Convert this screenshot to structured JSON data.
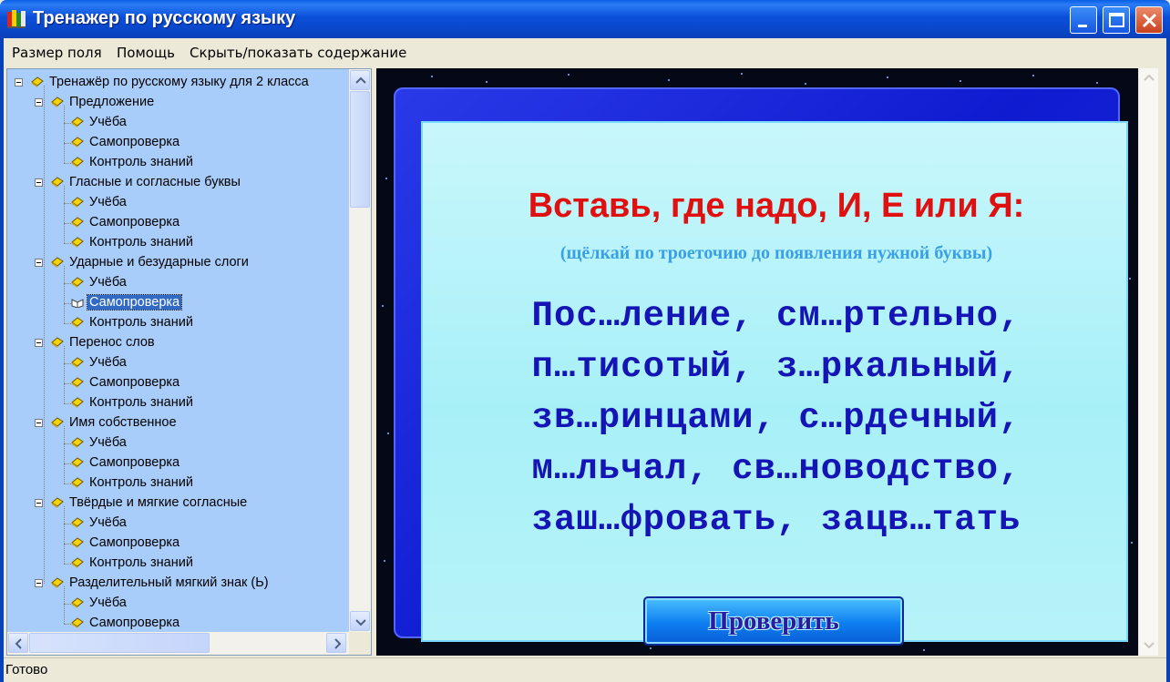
{
  "window": {
    "title": "Тренажер по русскому языку"
  },
  "menu": {
    "items": [
      "Размер поля",
      "Помощь",
      "Скрыть/показать содержание"
    ]
  },
  "tree": {
    "root": "Тренажёр по русскому языку для 2 класса",
    "sections": [
      {
        "label": "Предложение",
        "children": [
          "Учёба",
          "Самопроверка",
          "Контроль знаний"
        ]
      },
      {
        "label": "Гласные и согласные буквы",
        "children": [
          "Учёба",
          "Самопроверка",
          "Контроль знаний"
        ]
      },
      {
        "label": "Ударные и безударные слоги",
        "children": [
          "Учёба",
          "Самопроверка",
          "Контроль знаний"
        ]
      },
      {
        "label": "Перенос слов",
        "children": [
          "Учёба",
          "Самопроверка",
          "Контроль знаний"
        ]
      },
      {
        "label": "Имя собственное",
        "children": [
          "Учёба",
          "Самопроверка",
          "Контроль знаний"
        ]
      },
      {
        "label": "Твёрдые и мягкие согласные",
        "children": [
          "Учёба",
          "Самопроверка",
          "Контроль знаний"
        ]
      },
      {
        "label": "Разделительный мягкий знак (Ь)",
        "children": [
          "Учёба",
          "Самопроверка"
        ]
      }
    ],
    "selected": {
      "section": 2,
      "child": 1
    }
  },
  "exercise": {
    "title": "Вставь, где надо, И, Е или Я:",
    "hint": "(щёлкай по троеточию до появления нужной буквы)",
    "lines": [
      "Пос…ление, см…ртельно,",
      "п…тисотый, з…ркальный,",
      "зв…ринцами, с…рдечный,",
      "м…льчал, св…новодство,",
      "заш…фровать, зацв…тать"
    ],
    "check_button": "Проверить"
  },
  "status": {
    "text": "Готово"
  },
  "colors": {
    "title_bar": "#0a46c8",
    "tree_background": "#a9cdfa",
    "selection": "#316ac5",
    "task_title": "#e01010",
    "task_hint": "#3aa0e6",
    "words": "#1515b5",
    "card_frame": "#1522d8",
    "card_fill": "#b0f1f9"
  },
  "icons": {
    "app": "app-books-icon",
    "tree_node": "closed-book-icon",
    "tree_selected": "open-book-icon"
  }
}
